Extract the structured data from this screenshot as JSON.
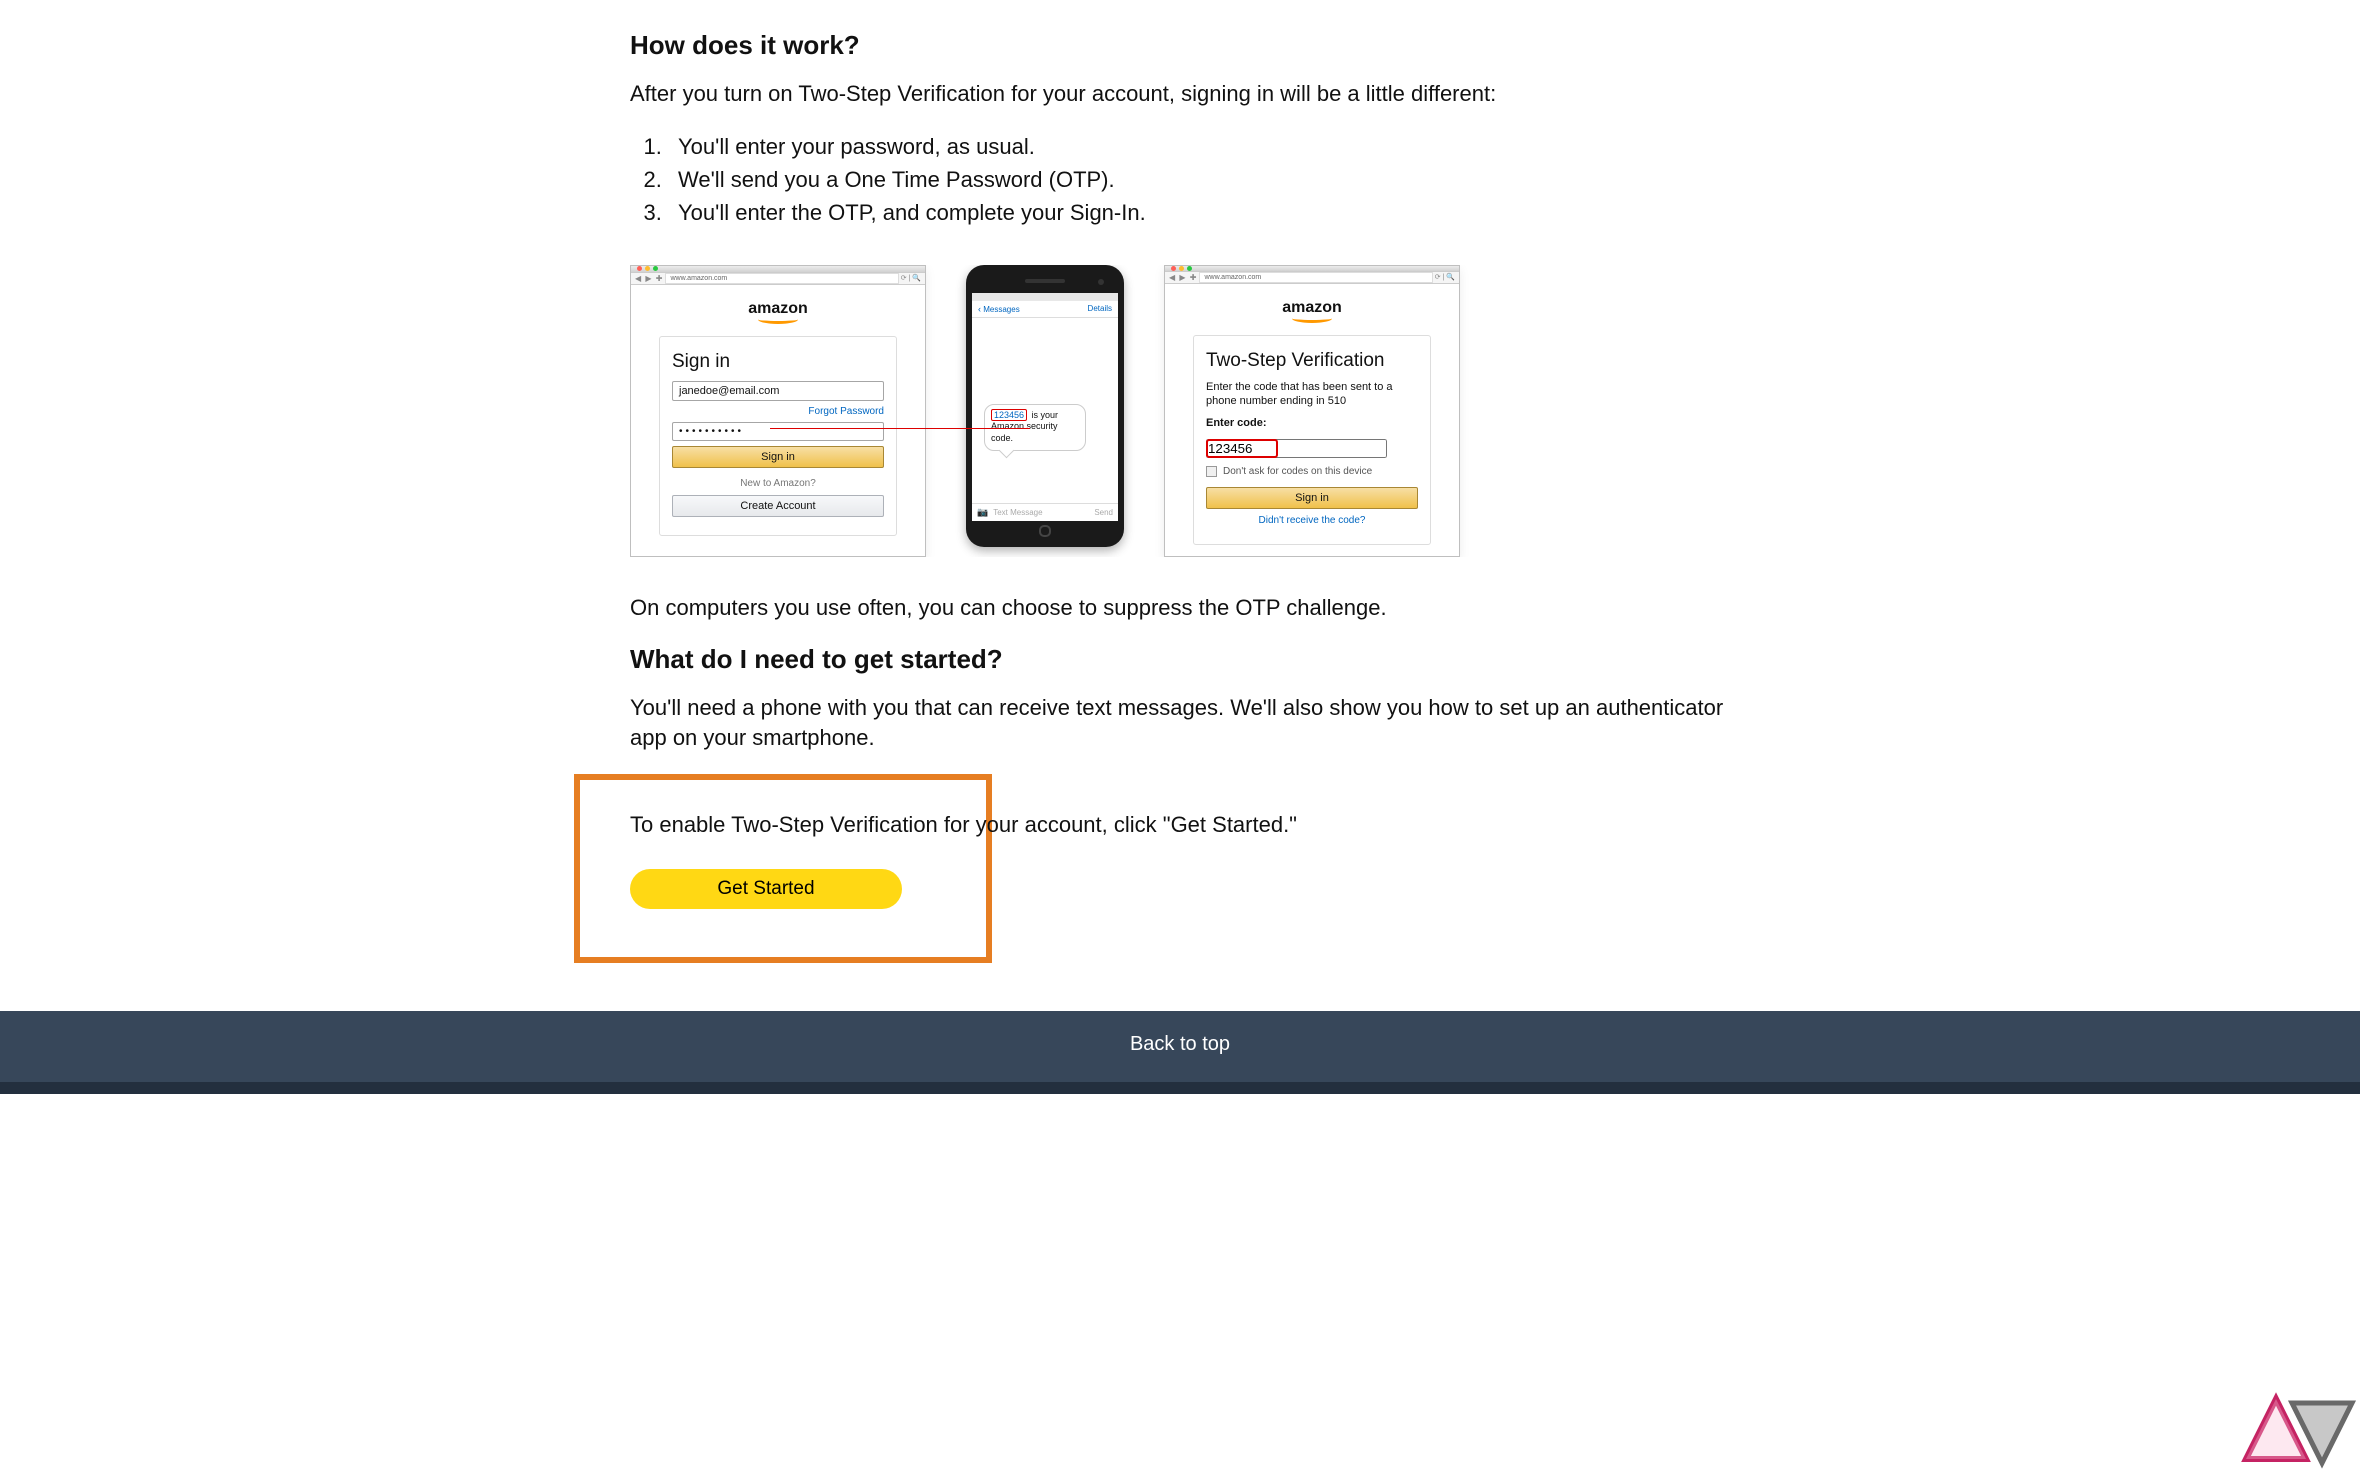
{
  "section1": {
    "heading": "How does it work?",
    "intro": "After you turn on Two-Step Verification for your account, signing in will be a little different:",
    "steps": [
      "You'll enter your password, as usual.",
      "We'll send you a One Time Password (OTP).",
      "You'll enter the OTP, and complete your Sign-In."
    ]
  },
  "illustration": {
    "browser_url": "www.amazon.com",
    "logo": "amazon",
    "panel1": {
      "title": "Sign in",
      "email": "janedoe@email.com",
      "forgot": "Forgot Password",
      "password": "••••••••••",
      "signin_btn": "Sign in",
      "new_text": "New to Amazon?",
      "create_btn": "Create Account"
    },
    "phone": {
      "nav_back": "Messages",
      "nav_details": "Details",
      "bubble_code": "123456",
      "bubble_text": " is your Amazon security code.",
      "inputbar_placeholder": "Text Message",
      "inputbar_send": "Send"
    },
    "panel3": {
      "title": "Two-Step Verification",
      "subtitle": "Enter the code that has been sent to a phone number ending in 510",
      "enter_label": "Enter code:",
      "code_value": "123456",
      "checkbox_label": "Don't ask for codes on this device",
      "signin_btn": "Sign in",
      "resend_link": "Didn't receive the code?"
    }
  },
  "suppress_text": "On computers you use often, you can choose to suppress the OTP challenge.",
  "section2": {
    "heading": "What do I need to get started?",
    "body": "You'll need a phone with you that can receive text messages. We'll also show you how to set up an authenticator app on your smartphone."
  },
  "enable_text": "To enable Two-Step Verification for your account, click \"Get Started.\"",
  "get_started_btn": "Get Started",
  "footer_text": "Back to top"
}
